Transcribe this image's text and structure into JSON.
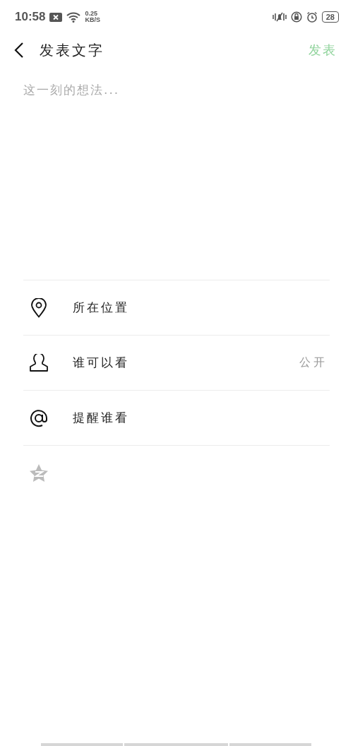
{
  "status_bar": {
    "time": "10:58",
    "speed_value": "0.25",
    "speed_unit": "KB/S",
    "battery": "28"
  },
  "header": {
    "title": "发表文字",
    "action": "发表"
  },
  "composer": {
    "placeholder": "这一刻的想法..."
  },
  "options": [
    {
      "kind": "location",
      "label": "所在位置"
    },
    {
      "kind": "audience",
      "label": "谁可以看",
      "value": "公开"
    },
    {
      "kind": "mention",
      "label": "提醒谁看"
    },
    {
      "kind": "qzone"
    }
  ]
}
